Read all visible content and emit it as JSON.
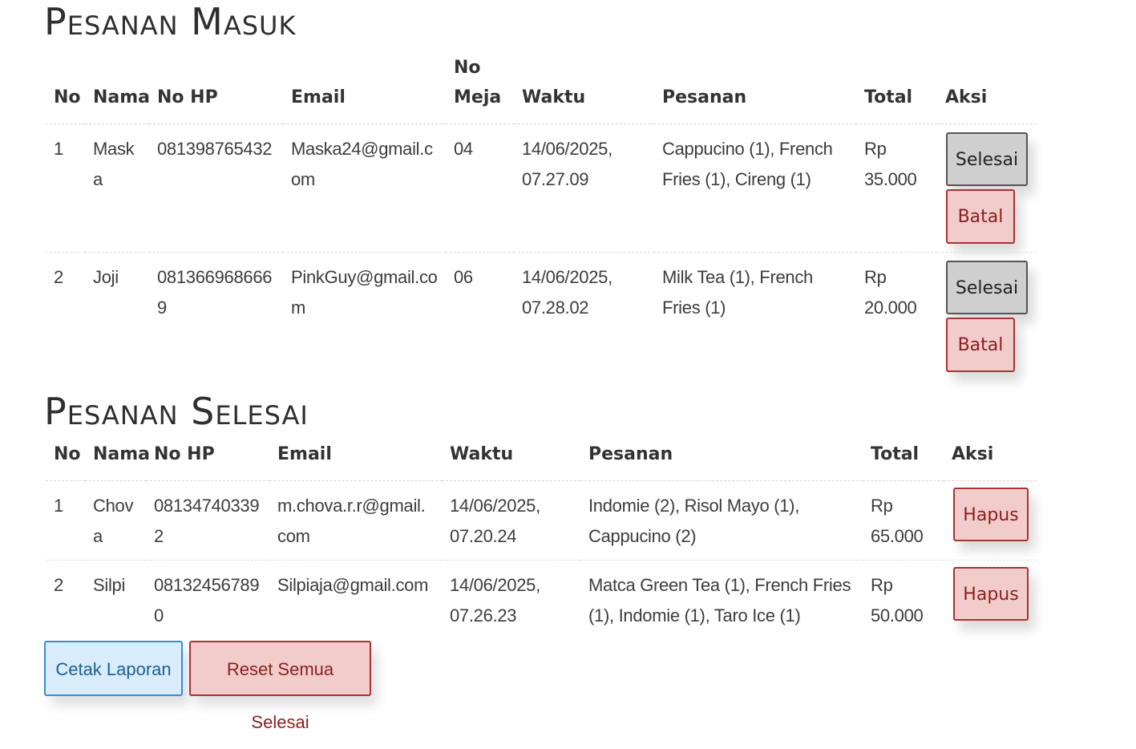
{
  "masuk": {
    "title": "Pesanan Masuk",
    "headers": {
      "no": "No",
      "nama": "Nama",
      "no_hp": "No HP",
      "email": "Email",
      "no_meja": "No Meja",
      "waktu": "Waktu",
      "pesanan": "Pesanan",
      "total": "Total",
      "aksi": "Aksi"
    },
    "rows": [
      {
        "no": "1",
        "nama": "Maska",
        "no_hp": "081398765432",
        "email": "Maska24@gmail.com",
        "no_meja": "04",
        "waktu": "14/06/2025, 07.27.09",
        "pesanan": "Cappucino (1), French Fries (1), Cireng (1)",
        "total": "Rp 35.000",
        "selesai_label": "Selesai",
        "batal_label": "Batal"
      },
      {
        "no": "2",
        "nama": "Joji",
        "no_hp": "0813669686669",
        "email": "PinkGuy@gmail.com",
        "no_meja": "06",
        "waktu": "14/06/2025, 07.28.02",
        "pesanan": "Milk Tea (1), French Fries (1)",
        "total": "Rp 20.000",
        "selesai_label": "Selesai",
        "batal_label": "Batal"
      }
    ]
  },
  "selesai": {
    "title": "Pesanan Selesai",
    "headers": {
      "no": "No",
      "nama": "Nama",
      "no_hp": "No HP",
      "email": "Email",
      "waktu": "Waktu",
      "pesanan": "Pesanan",
      "total": "Total",
      "aksi": "Aksi"
    },
    "rows": [
      {
        "no": "1",
        "nama": "Chova",
        "no_hp": "081347403392",
        "email": "m.chova.r.r@gmail.com",
        "waktu": "14/06/2025, 07.20.24",
        "pesanan": "Indomie (2), Risol Mayo (1), Cappucino (2)",
        "total": "Rp 65.000",
        "hapus_label": "Hapus"
      },
      {
        "no": "2",
        "nama": "Silpi",
        "no_hp": "081324567890",
        "email": "Silpiaja@gmail.com",
        "waktu": "14/06/2025, 07.26.23",
        "pesanan": "Matca Green Tea (1), French Fries (1), Indomie (1), Taro Ice (1)",
        "total": "Rp 50.000",
        "hapus_label": "Hapus"
      }
    ]
  },
  "footer": {
    "cetak_label": "Cetak Laporan",
    "reset_label": "Reset Semua Selesai"
  },
  "colors": {
    "danger_bg": "#f2cbcb",
    "danger_border": "#aa3333",
    "neutral_bg": "#cfcfcf",
    "primary_bg": "#d8ecfb",
    "primary_border": "#3b8ed0"
  }
}
